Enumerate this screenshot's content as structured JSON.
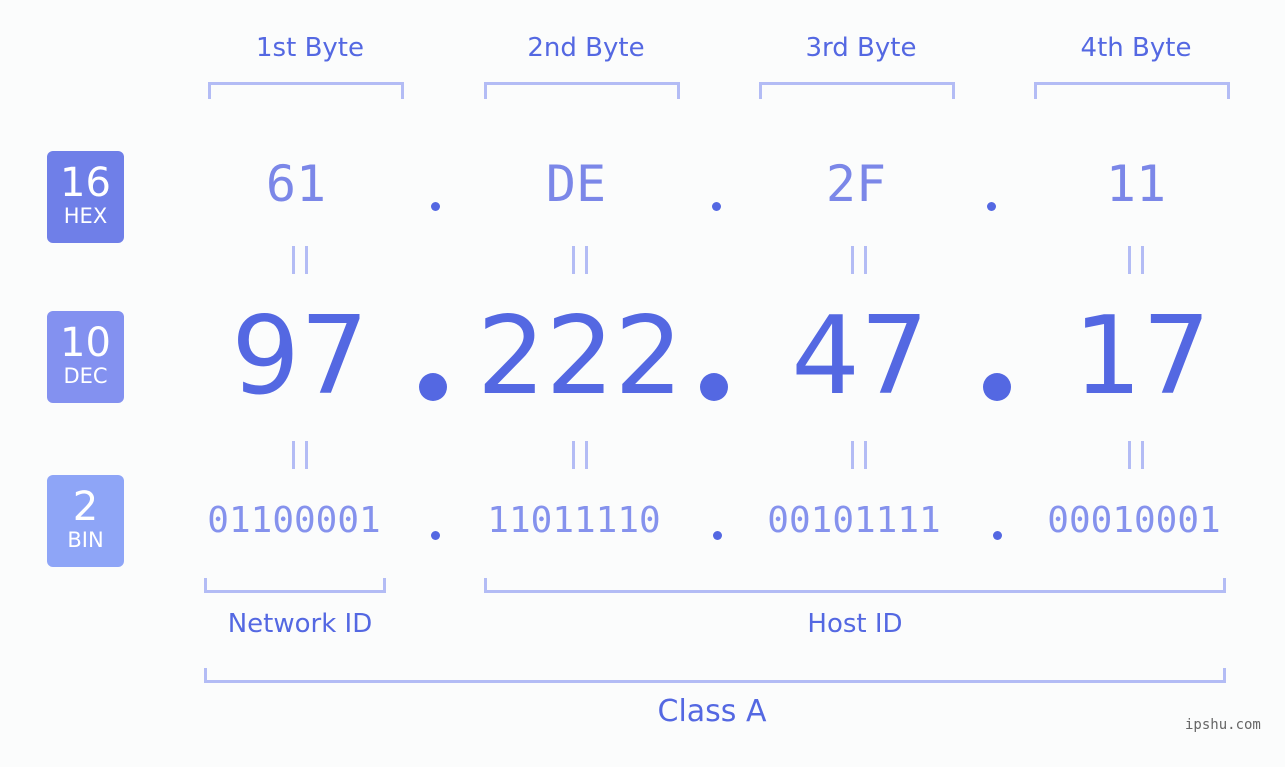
{
  "byte_headers": [
    "1st Byte",
    "2nd Byte",
    "3rd Byte",
    "4th Byte"
  ],
  "badges": [
    {
      "base": "16",
      "label": "HEX",
      "color": "#6f7fe8"
    },
    {
      "base": "10",
      "label": "DEC",
      "color": "#8391f0"
    },
    {
      "base": "2",
      "label": "BIN",
      "color": "#8ea5f7"
    }
  ],
  "hex": [
    "61",
    "DE",
    "2F",
    "11"
  ],
  "dec": [
    "97",
    "222",
    "47",
    "17"
  ],
  "bin": [
    "01100001",
    "11011110",
    "00101111",
    "00010001"
  ],
  "separator": ".",
  "equals_symbol": "=",
  "groups": {
    "network": "Network ID",
    "host": "Host ID",
    "class": "Class A"
  },
  "watermark": "ipshu.com",
  "colors": {
    "accent": "#5468e2",
    "bracket": "#b3bcf5",
    "background": "#fbfcfc"
  }
}
